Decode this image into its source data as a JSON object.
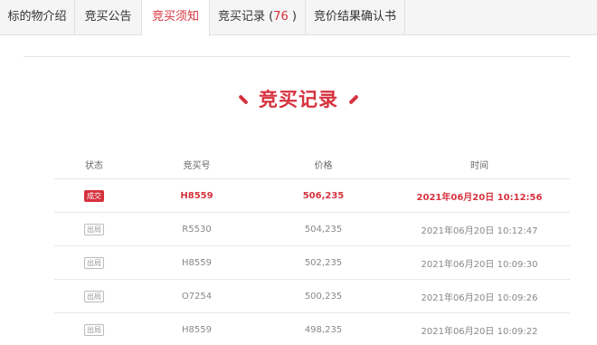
{
  "tabs": [
    {
      "label": "标的物介绍"
    },
    {
      "label": "竞买公告"
    },
    {
      "label": "竞买须知"
    },
    {
      "label": "竞买记录 (",
      "count": "76",
      "suffix": " )"
    },
    {
      "label": "竞价结果确认书"
    }
  ],
  "active_tab": "竞买须知",
  "section": {
    "title": "竞买记录"
  },
  "table": {
    "headers": [
      "状态",
      "竞买号",
      "价格",
      "时间"
    ],
    "rows": [
      {
        "status": "成交",
        "bidder": "H8559",
        "price": "506,235",
        "time": "2021年06月20日 10:12:56"
      },
      {
        "status": "出局",
        "bidder": "R5530",
        "price": "504,235",
        "time": "2021年06月20日 10:12:47"
      },
      {
        "status": "出局",
        "bidder": "H8559",
        "price": "502,235",
        "time": "2021年06月20日 10:09:30"
      },
      {
        "status": "出局",
        "bidder": "O7254",
        "price": "500,235",
        "time": "2021年06月20日 10:09:26"
      },
      {
        "status": "出局",
        "bidder": "H8559",
        "price": "498,235",
        "time": "2021年06月20日 10:09:22"
      }
    ]
  },
  "colors": {
    "accent": "#d6323e"
  }
}
